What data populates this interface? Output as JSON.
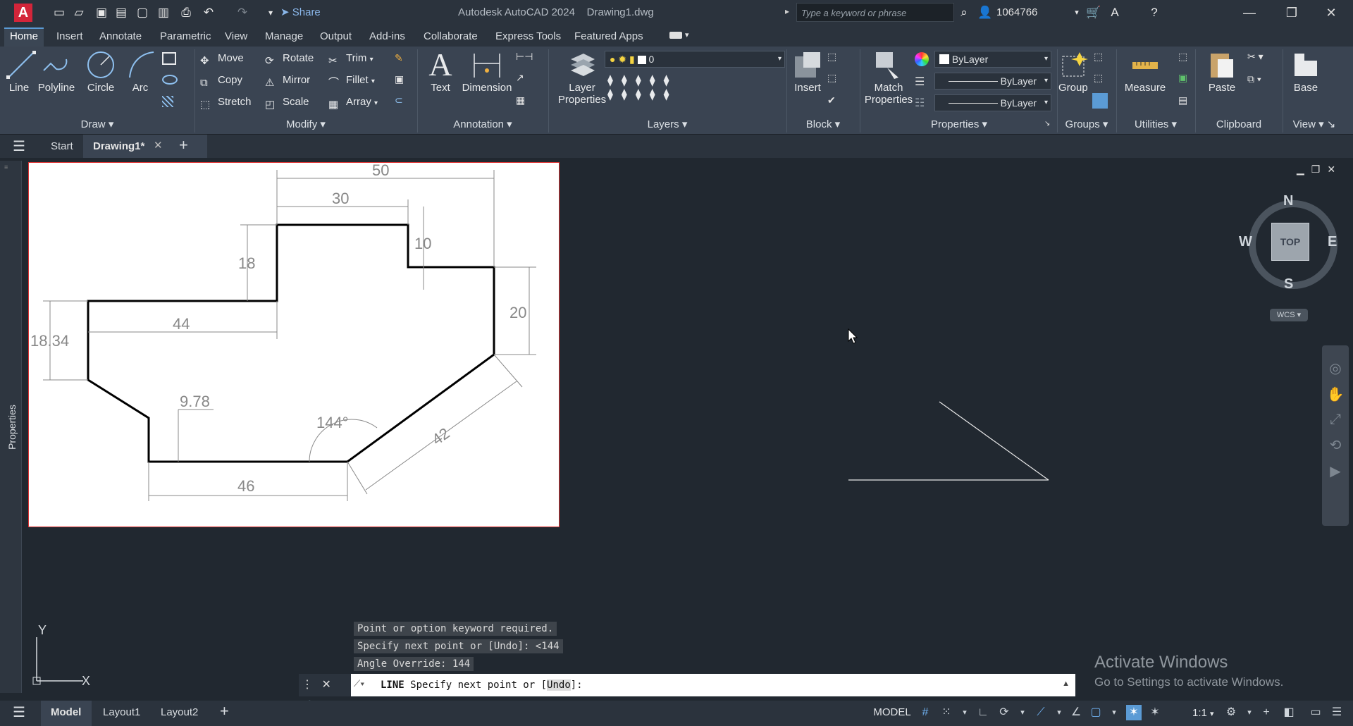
{
  "titlebar": {
    "app_title": "Autodesk AutoCAD 2024",
    "file_title": "Drawing1.dwg",
    "share_label": "Share",
    "search_placeholder": "Type a keyword or phrase",
    "user_id": "1064766"
  },
  "ribbon_tabs": [
    "Home",
    "Insert",
    "Annotate",
    "Parametric",
    "View",
    "Manage",
    "Output",
    "Add-ins",
    "Collaborate",
    "Express Tools",
    "Featured Apps"
  ],
  "ribbon": {
    "draw": {
      "title": "Draw",
      "line": "Line",
      "polyline": "Polyline",
      "circle": "Circle",
      "arc": "Arc"
    },
    "modify": {
      "title": "Modify",
      "move": "Move",
      "rotate": "Rotate",
      "trim": "Trim",
      "copy": "Copy",
      "mirror": "Mirror",
      "fillet": "Fillet",
      "stretch": "Stretch",
      "scale": "Scale",
      "array": "Array"
    },
    "annotation": {
      "title": "Annotation",
      "text": "Text",
      "dimension": "Dimension"
    },
    "layers": {
      "title": "Layers",
      "layer_properties_1": "Layer",
      "layer_properties_2": "Properties",
      "current_layer": "0"
    },
    "block": {
      "title": "Block",
      "insert": "Insert"
    },
    "properties": {
      "title": "Properties",
      "match_1": "Match",
      "match_2": "Properties",
      "color": "ByLayer",
      "linetype": "ByLayer",
      "lineweight": "ByLayer"
    },
    "groups": {
      "title": "Groups",
      "group": "Group"
    },
    "utilities": {
      "title": "Utilities",
      "measure": "Measure"
    },
    "clipboard": {
      "title": "Clipboard",
      "paste": "Paste"
    },
    "view": {
      "title": "View",
      "base": "Base"
    }
  },
  "file_tabs": {
    "start": "Start",
    "drawing": "Drawing1*"
  },
  "side_palette": {
    "label": "Properties"
  },
  "reference_image": {
    "dims": [
      "50",
      "30",
      "10",
      "18",
      "20",
      "44",
      "18.34",
      "9.78",
      "144°",
      "42",
      "46"
    ]
  },
  "viewcube": {
    "north": "N",
    "south": "S",
    "east": "E",
    "west": "W",
    "face": "TOP",
    "wcs": "WCS"
  },
  "ucs": {
    "x": "X",
    "y": "Y"
  },
  "command": {
    "history": [
      "Point or option keyword required.",
      "Specify next point or [Undo]: <144",
      "Angle Override: 144"
    ],
    "prompt_cmd": "LINE",
    "prompt_text": "Specify next point or [",
    "prompt_option": "Undo",
    "prompt_end": "]:"
  },
  "watermark": {
    "line1": "Activate Windows",
    "line2": "Go to Settings to activate Windows."
  },
  "status": {
    "model_tab": "Model",
    "layout1": "Layout1",
    "layout2": "Layout2",
    "model_label": "MODEL",
    "scale": "1:1"
  },
  "colors": {
    "accent": "#5b9bd5",
    "canvas": "#212830",
    "ribbon": "#3a4452",
    "autocad_red": "#d3253a"
  }
}
